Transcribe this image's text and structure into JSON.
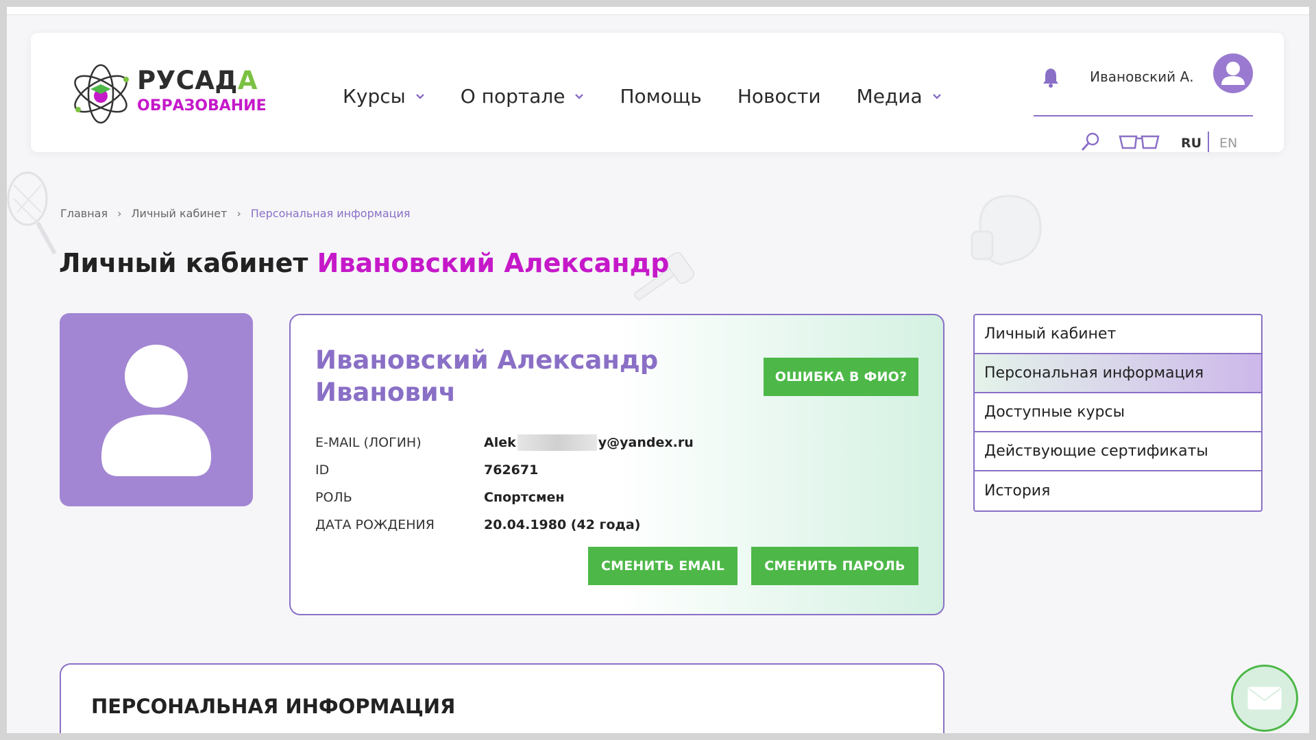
{
  "header": {
    "logo": {
      "line1": "РУСАДА",
      "line2": "ОБРАЗОВАНИЕ"
    },
    "nav": [
      {
        "label": "Курсы",
        "has_dropdown": true
      },
      {
        "label": "О портале",
        "has_dropdown": true
      },
      {
        "label": "Помощь",
        "has_dropdown": false
      },
      {
        "label": "Новости",
        "has_dropdown": false
      },
      {
        "label": "Медиа",
        "has_dropdown": true
      }
    ],
    "user_name": "Ивановский А.",
    "lang": {
      "ru": "RU",
      "en": "EN",
      "active": "RU"
    }
  },
  "breadcrumb": [
    {
      "label": "Главная"
    },
    {
      "label": "Личный кабинет"
    },
    {
      "label": "Персональная информация"
    }
  ],
  "page_title": {
    "prefix": "Личный кабинет",
    "name": "Ивановский Александр"
  },
  "profile": {
    "full_name": "Ивановский Александр Иванович",
    "fio_error_button": "ОШИБКА В ФИО?",
    "fields": [
      {
        "key": "E-MAIL (ЛОГИН)",
        "value_start": "Alek",
        "value_end": "y@yandex.ru",
        "redacted": true
      },
      {
        "key": "ID",
        "value": "762671"
      },
      {
        "key": "РОЛЬ",
        "value": "Спортсмен"
      },
      {
        "key": "ДАТА РОЖДЕНИЯ",
        "value": "20.04.1980 (42 года)"
      }
    ],
    "change_email_button": "СМЕНИТЬ EMAIL",
    "change_password_button": "СМЕНИТЬ ПАРОЛЬ"
  },
  "side_menu": [
    {
      "label": "Личный кабинет",
      "active": false
    },
    {
      "label": "Персональная информация",
      "active": true
    },
    {
      "label": "Доступные курсы",
      "active": false
    },
    {
      "label": "Действующие сертификаты",
      "active": false
    },
    {
      "label": "История",
      "active": false
    }
  ],
  "section": {
    "title": "ПЕРСОНАЛЬНАЯ ИНФОРМАЦИЯ"
  },
  "colors": {
    "accent_purple": "#8a6fc6",
    "accent_magenta": "#c519c9",
    "button_green": "#4db848",
    "avatar_bg": "#a386d3"
  },
  "icons": [
    "bell-icon",
    "user-avatar-icon",
    "search-icon",
    "glasses-icon",
    "chevron-down-icon",
    "mail-icon"
  ]
}
